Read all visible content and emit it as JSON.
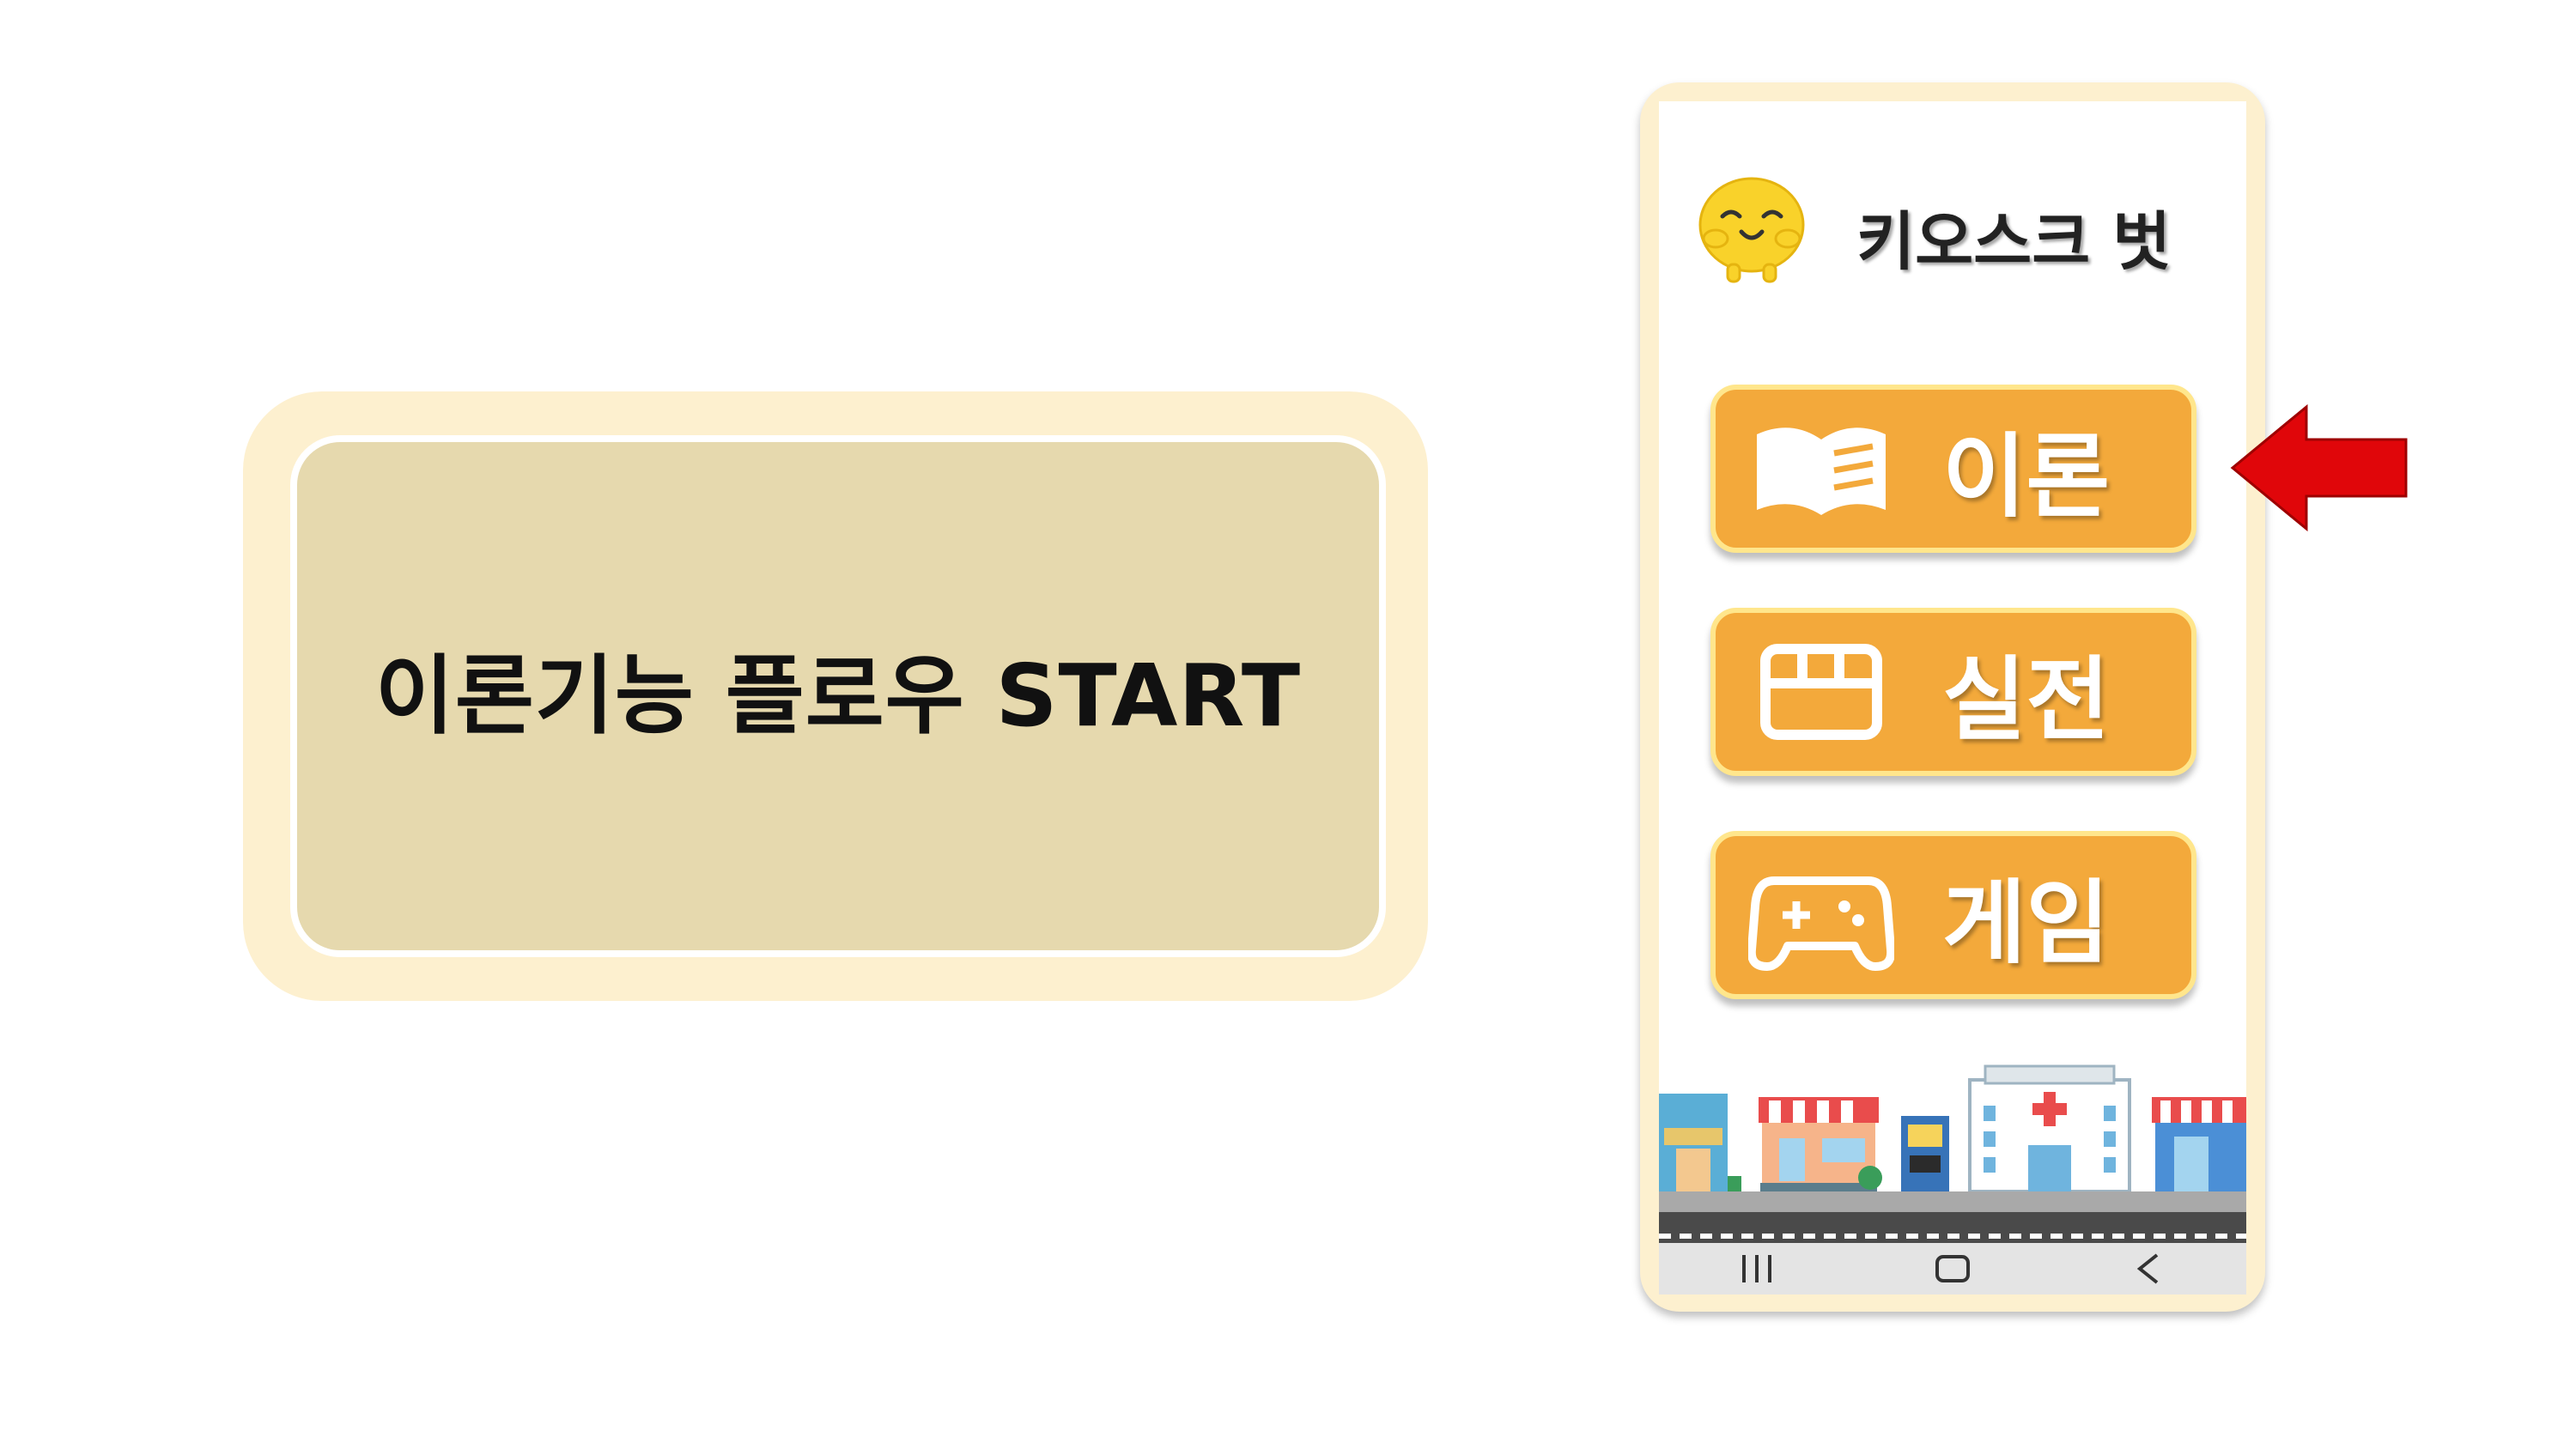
{
  "flow_card": {
    "title": "이론기능 플로우 START"
  },
  "app": {
    "title": "키오스크 벗",
    "menu": [
      {
        "label": "이론",
        "icon": "book-icon"
      },
      {
        "label": "실전",
        "icon": "store-icon"
      },
      {
        "label": "게임",
        "icon": "gamepad-icon"
      }
    ],
    "navbar": [
      "recent-apps-icon",
      "home-icon",
      "back-icon"
    ]
  },
  "colors": {
    "card_outer": "#fdf0cf",
    "card_inner": "#e6d9ae",
    "button": "#f3a93b",
    "button_border": "#ffe68c",
    "arrow": "#e0060a"
  }
}
